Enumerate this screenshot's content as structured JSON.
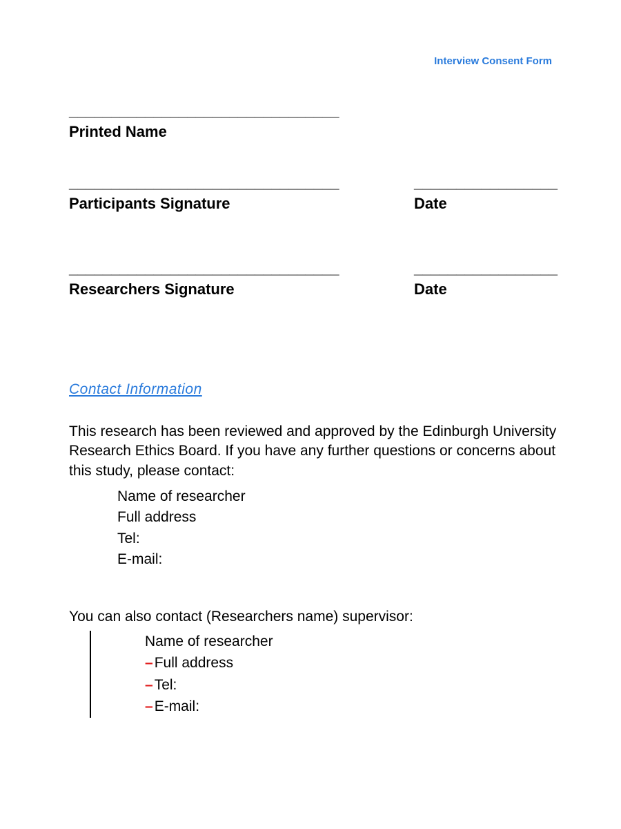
{
  "header": {
    "form_title": "Interview Consent Form"
  },
  "signatures": {
    "underline_long": "________________________________",
    "underline_short": "_________________",
    "printed_name_label": "Printed Name",
    "participant_label": "Participants Signature",
    "researcher_label": "Researchers Signature",
    "date_label": "Date"
  },
  "contact": {
    "heading": "Contact Information",
    "intro": "This research has been reviewed and approved by the Edinburgh University Research Ethics Board. If you have any further questions or concerns about this study, please contact:",
    "researcher": {
      "name_line": "Name of researcher",
      "address_line": "Full address",
      "tel_line": "Tel:",
      "email_line": "E-mail:"
    },
    "supervisor_intro": "You can also contact (Researchers name) supervisor:",
    "supervisor": {
      "name_line": "Name of researcher",
      "address_line": "Full address",
      "tel_line": "Tel:",
      "email_line": "E-mail:"
    }
  },
  "glyphs": {
    "dash": "–"
  }
}
